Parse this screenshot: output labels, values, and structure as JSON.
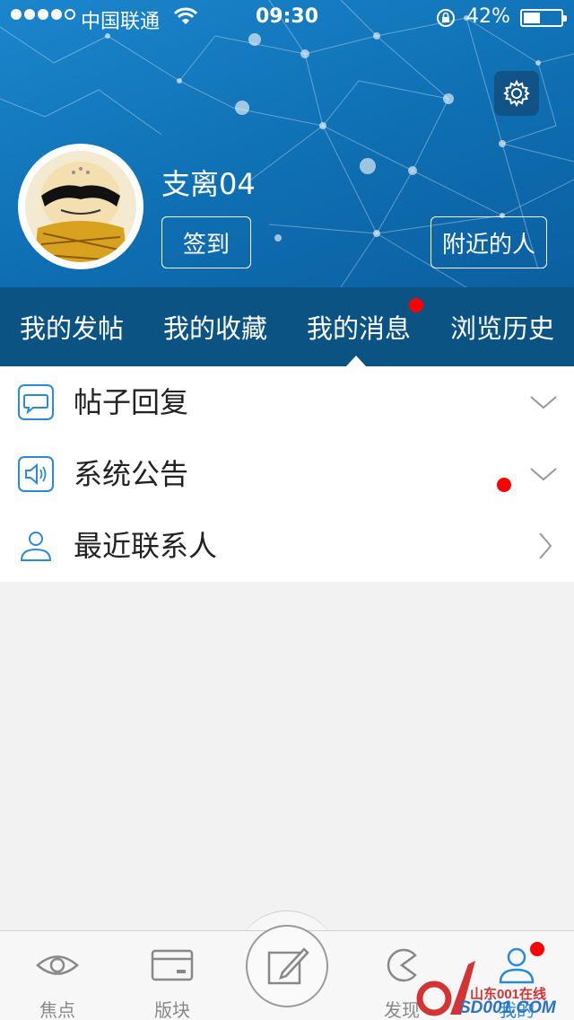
{
  "status_bar": {
    "carrier": "中国联通",
    "time": "09:30",
    "battery": "42%"
  },
  "profile": {
    "username": "支离04",
    "checkin_label": "签到",
    "nearby_label": "附近的人"
  },
  "tabs": [
    {
      "label": "我的发帖"
    },
    {
      "label": "我的收藏"
    },
    {
      "label": "我的消息",
      "has_badge": true,
      "active": true
    },
    {
      "label": "浏览历史"
    }
  ],
  "messages": [
    {
      "label": "帖子回复",
      "icon": "chat-bubble-icon",
      "chevron": "down"
    },
    {
      "label": "系统公告",
      "icon": "speaker-icon",
      "chevron": "down",
      "has_badge": true
    },
    {
      "label": "最近联系人",
      "icon": "person-icon",
      "chevron": "right"
    }
  ],
  "tabbar": {
    "focus": "焦点",
    "boards": "版块",
    "discover": "发现",
    "me": "我的"
  },
  "watermark": {
    "brand": "山东001在线",
    "site": "SD001.COM"
  },
  "colors": {
    "hero_blue": "#1479bf",
    "tab_bar_blue": "#0a5383",
    "badge_red": "#ff0000",
    "icon_blue": "#2a8ad8"
  }
}
